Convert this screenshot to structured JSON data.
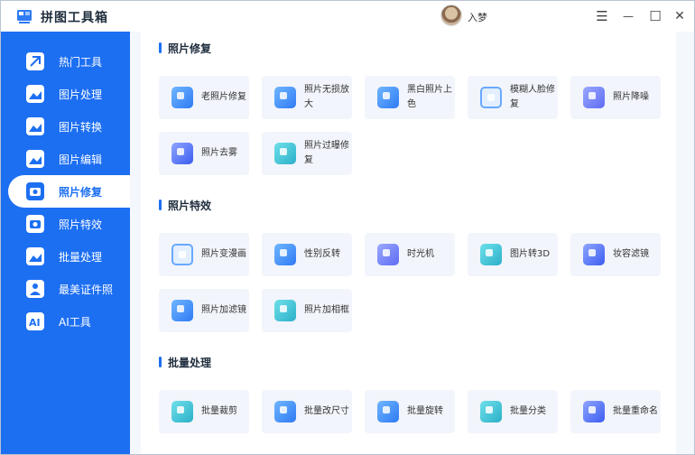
{
  "app": {
    "title": "拼图工具箱",
    "username": "入梦"
  },
  "window_controls": {
    "menu": "☰",
    "minimize": "—",
    "maximize": "☐",
    "close": "✕"
  },
  "colors": {
    "accent": "#1d6ff2",
    "tile_bg": "#f2f5fb",
    "main_bg": "#f4f7fc"
  },
  "sidebar": {
    "items": [
      {
        "label": "热门工具",
        "icon": "hot-tools-icon"
      },
      {
        "label": "图片处理",
        "icon": "image-process-icon"
      },
      {
        "label": "图片转换",
        "icon": "image-convert-icon"
      },
      {
        "label": "图片编辑",
        "icon": "image-edit-icon"
      },
      {
        "label": "照片修复",
        "icon": "photo-repair-icon",
        "active": true
      },
      {
        "label": "照片特效",
        "icon": "photo-effects-icon"
      },
      {
        "label": "批量处理",
        "icon": "batch-process-icon"
      },
      {
        "label": "最美证件照",
        "icon": "id-photo-icon"
      },
      {
        "label": "AI工具",
        "icon": "ai-tools-icon"
      }
    ]
  },
  "sections": [
    {
      "title": "照片修复",
      "tools": [
        "老照片修复",
        "照片无损放大",
        "黑白照片上色",
        "模糊人脸修复",
        "照片降噪",
        "照片去雾",
        "照片过曝修复"
      ]
    },
    {
      "title": "照片特效",
      "tools": [
        "照片变漫画",
        "性别反转",
        "时光机",
        "图片转3D",
        "妆容滤镜",
        "照片加滤镜",
        "照片加相框"
      ]
    },
    {
      "title": "批量处理",
      "tools": [
        "批量裁剪",
        "批量改尺寸",
        "批量旋转",
        "批量分类",
        "批量重命名"
      ]
    }
  ]
}
